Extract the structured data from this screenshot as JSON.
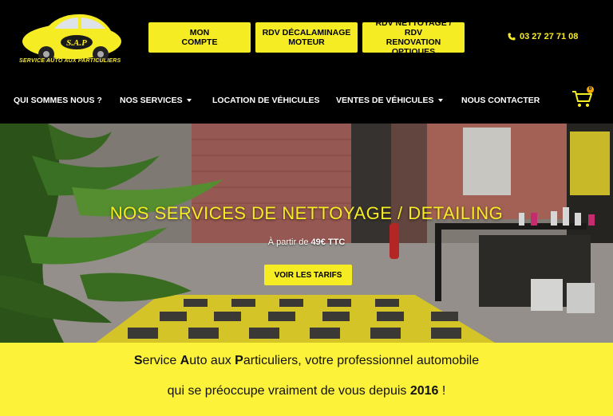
{
  "header": {
    "logo_text": "S.A.P",
    "logo_tagline": "SERVICE AUTO AUX PARTICULIERS",
    "buttons": [
      {
        "line1": "MON",
        "line2": "COMPTE"
      },
      {
        "line1": "RDV DÉCALAMINAGE",
        "line2": "MOTEUR"
      },
      {
        "line1": "RDV NETTOYAGE / RDV",
        "line2": "RENOVATION OPTIQUES"
      }
    ],
    "phone": "03 27 27 71 08"
  },
  "nav": {
    "items": [
      {
        "label": "QUI SOMMES NOUS ?",
        "dropdown": false
      },
      {
        "label": "NOS SERVICES",
        "dropdown": true
      },
      {
        "label": "LOCATION DE VÉHICULES",
        "dropdown": false
      },
      {
        "label": "VENTES DE VÉHICULES",
        "dropdown": true
      },
      {
        "label": "NOUS CONTACTER",
        "dropdown": false
      }
    ],
    "cart_count": "0"
  },
  "hero": {
    "title": "NOS SERVICES DE NETTOYAGE / DETAILING",
    "price_prefix": "À partir de ",
    "price_value": "49€ TTC",
    "cta": "VOIR LES TARIFS"
  },
  "band": {
    "line1": {
      "s": "S",
      "part1": "ervice ",
      "a": "A",
      "part2": "uto aux ",
      "p": "P",
      "part3": "articuliers, votre professionnel automobile"
    },
    "line2": {
      "part1": "qui se préoccupe vraiment de vous depuis ",
      "year": "2016",
      "part2": " !"
    }
  },
  "colors": {
    "accent": "#f6ec24",
    "background": "#000000",
    "band": "#fdf23a"
  }
}
